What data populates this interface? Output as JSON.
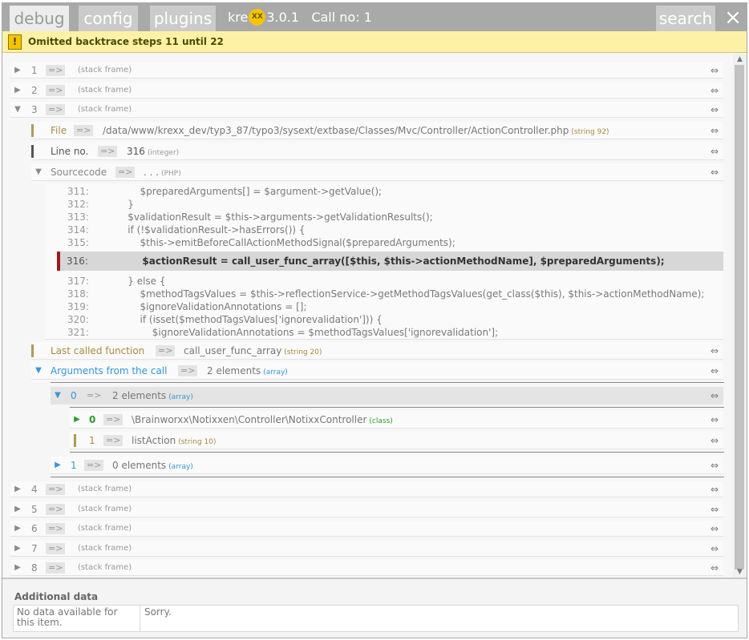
{
  "header": {
    "tabs": [
      {
        "label": "debug",
        "active": true
      },
      {
        "label": "config"
      },
      {
        "label": "plugins"
      }
    ],
    "brand_prefix": "kre",
    "brand_logo": "XX",
    "version": "3.0.1",
    "call_no": "Call no: 1",
    "search_label": "search",
    "close_icon": "×"
  },
  "message": {
    "icon": "!",
    "text": "Omitted backtrace steps 11 until 22"
  },
  "frames_top": [
    {
      "key": "1",
      "note": "(stack frame)",
      "toggle": "▶"
    },
    {
      "key": "2",
      "note": "(stack frame)",
      "toggle": "▶"
    },
    {
      "key": "3",
      "note": "(stack frame)",
      "toggle": "▼"
    }
  ],
  "frame3": {
    "file": {
      "key": "File",
      "value": "/data/www/krexx_dev/typ3_87/typo3/sysext/extbase/Classes/Mvc/Controller/ActionController.php",
      "type": "(string 92)"
    },
    "line_no": {
      "key": "Line no.",
      "value": "316",
      "type": "(integer)"
    },
    "sourcecode": {
      "key": "Sourcecode",
      "value": ". . .",
      "type": "(PHP)"
    },
    "source_lines": [
      {
        "n": "311:",
        "code": "        $preparedArguments[] = $argument->getValue();"
      },
      {
        "n": "312:",
        "code": "    }"
      },
      {
        "n": "313:",
        "code": "    $validationResult = $this->arguments->getValidationResults();"
      },
      {
        "n": "314:",
        "code": "    if (!$validationResult->hasErrors()) {"
      },
      {
        "n": "315:",
        "code": "        $this->emitBeforeCallActionMethodSignal($preparedArguments);"
      }
    ],
    "source_highlight": {
      "n": "316:",
      "code": "        $actionResult = call_user_func_array([$this, $this->actionMethodName], $preparedArguments);"
    },
    "source_lines_after": [
      {
        "n": "317:",
        "code": "    } else {"
      },
      {
        "n": "318:",
        "code": "        $methodTagsValues = $this->reflectionService->getMethodTagsValues(get_class($this), $this->actionMethodName);"
      },
      {
        "n": "319:",
        "code": "        $ignoreValidationAnnotations = [];"
      },
      {
        "n": "320:",
        "code": "        if (isset($methodTagsValues['ignorevalidation'])) {"
      },
      {
        "n": "321:",
        "code": "            $ignoreValidationAnnotations = $methodTagsValues['ignorevalidation'];"
      }
    ],
    "last_called": {
      "key": "Last called function",
      "value": "call_user_func_array",
      "type": "(string 20)"
    },
    "arguments": {
      "key": "Arguments from the call",
      "value": "2 elements",
      "type": "(array)"
    },
    "arg0": {
      "key": "0",
      "value": "2 elements",
      "type": "(array)"
    },
    "arg0_items": [
      {
        "key": "0",
        "value": "\\Brainworxx\\Notixxen\\Controller\\NotixxController",
        "type": "(class)"
      },
      {
        "key": "1",
        "value": "listAction",
        "type": "(string 10)"
      }
    ],
    "arg1": {
      "key": "1",
      "value": "0 elements",
      "type": "(array)"
    }
  },
  "frames_bottom": [
    {
      "key": "4",
      "note": "(stack frame)"
    },
    {
      "key": "5",
      "note": "(stack frame)"
    },
    {
      "key": "6",
      "note": "(stack frame)"
    },
    {
      "key": "7",
      "note": "(stack frame)"
    },
    {
      "key": "8",
      "note": "(stack frame)"
    }
  ],
  "arrow_text": "=>",
  "copy_icon": "⇔",
  "footer": {
    "title": "Additional data",
    "left": "No data available for this item.",
    "right": "Sorry."
  },
  "colors": {
    "header_bg": "#a9a9a9",
    "message_bg": "#fdf1a6",
    "gold": "#a88b3c",
    "blue": "#3497d6",
    "green": "#2b9e2b",
    "highlight_bar": "#9b1b1b"
  }
}
